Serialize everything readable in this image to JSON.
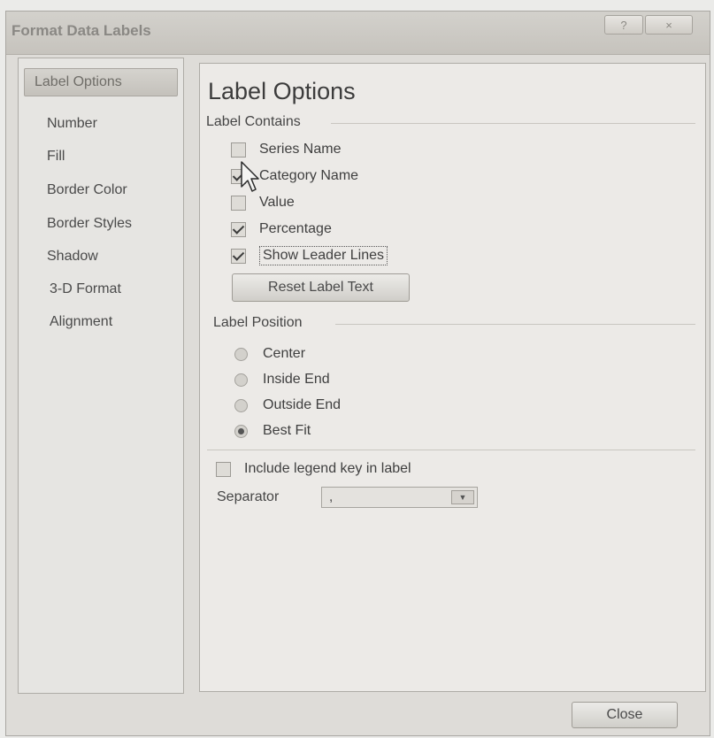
{
  "window": {
    "title": "Format Data Labels",
    "help_symbol": "?",
    "close_symbol": "×"
  },
  "nav": {
    "items": [
      {
        "label": "Label Options",
        "selected": true
      },
      {
        "label": "Number"
      },
      {
        "label": "Fill"
      },
      {
        "label": "Border Color"
      },
      {
        "label": "Border Styles"
      },
      {
        "label": "Shadow"
      },
      {
        "label": "3-D Format"
      },
      {
        "label": "Alignment"
      }
    ]
  },
  "panel": {
    "title": "Label Options",
    "label_contains": {
      "heading": "Label Contains",
      "options": [
        {
          "label": "Series Name",
          "checked": false
        },
        {
          "label": "Category Name",
          "checked": true
        },
        {
          "label": "Value",
          "checked": false
        },
        {
          "label": "Percentage",
          "checked": true
        },
        {
          "label": "Show Leader Lines",
          "checked": true
        }
      ],
      "reset_button": "Reset Label Text"
    },
    "label_position": {
      "heading": "Label Position",
      "options": [
        {
          "label": "Center",
          "selected": false
        },
        {
          "label": "Inside End",
          "selected": false
        },
        {
          "label": "Outside End",
          "selected": false
        },
        {
          "label": "Best Fit",
          "selected": true
        }
      ]
    },
    "include_legend_key": {
      "label": "Include legend key in label",
      "checked": false
    },
    "separator": {
      "label": "Separator",
      "value": ","
    }
  },
  "footer": {
    "close_button": "Close"
  },
  "icons": {
    "cursor": "mouse-pointer-icon",
    "dropdown": "chevron-down-icon"
  }
}
